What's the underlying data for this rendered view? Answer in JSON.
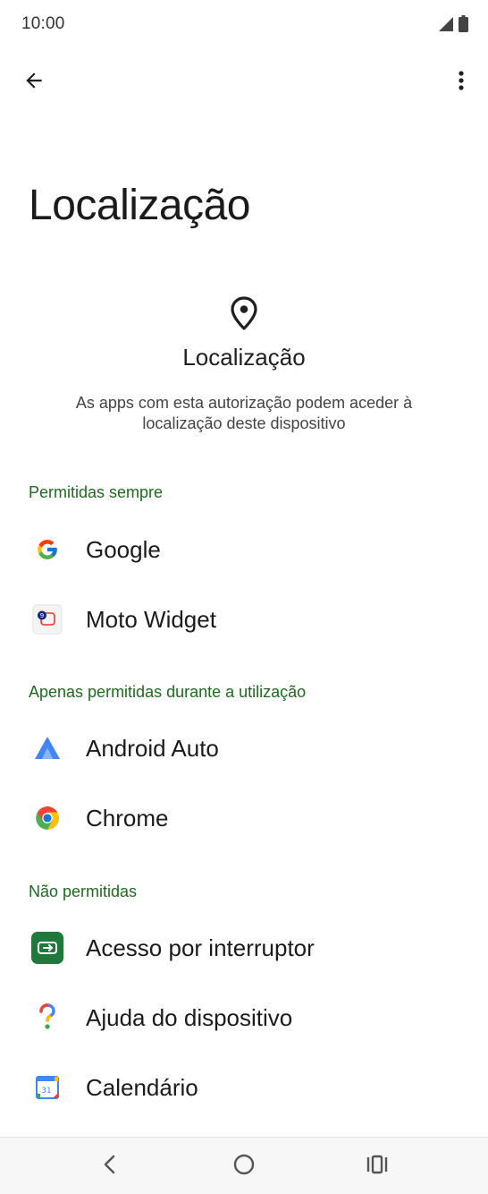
{
  "status_bar": {
    "time": "10:00",
    "signal_icon": "signal-icon",
    "battery_icon": "battery-icon"
  },
  "app_bar": {
    "back_icon": "arrow-back-icon",
    "more_icon": "more-vert-icon"
  },
  "page": {
    "title": "Localização"
  },
  "header": {
    "icon": "location-pin-icon",
    "title": "Localização",
    "description": "As apps com esta autorização podem aceder à localização deste dispositivo"
  },
  "sections": [
    {
      "title": "Permitidas sempre",
      "apps": [
        {
          "label": "Google",
          "icon": "google-icon"
        },
        {
          "label": "Moto Widget",
          "icon": "moto-widget-icon"
        }
      ]
    },
    {
      "title": "Apenas permitidas durante a utilização",
      "apps": [
        {
          "label": "Android Auto",
          "icon": "android-auto-icon"
        },
        {
          "label": "Chrome",
          "icon": "chrome-icon"
        }
      ]
    },
    {
      "title": "Não permitidas",
      "apps": [
        {
          "label": "Acesso por interruptor",
          "icon": "switch-access-icon"
        },
        {
          "label": "Ajuda do dispositivo",
          "icon": "device-help-icon"
        },
        {
          "label": "Calendário",
          "icon": "calendar-icon",
          "badge": "31"
        }
      ]
    }
  ],
  "nav_bar": {
    "back_icon": "nav-back-icon",
    "home_icon": "nav-home-icon",
    "recents_icon": "nav-recents-icon"
  },
  "colors": {
    "section_header": "#1e6b1e",
    "accent_green": "#1e6b1e"
  }
}
